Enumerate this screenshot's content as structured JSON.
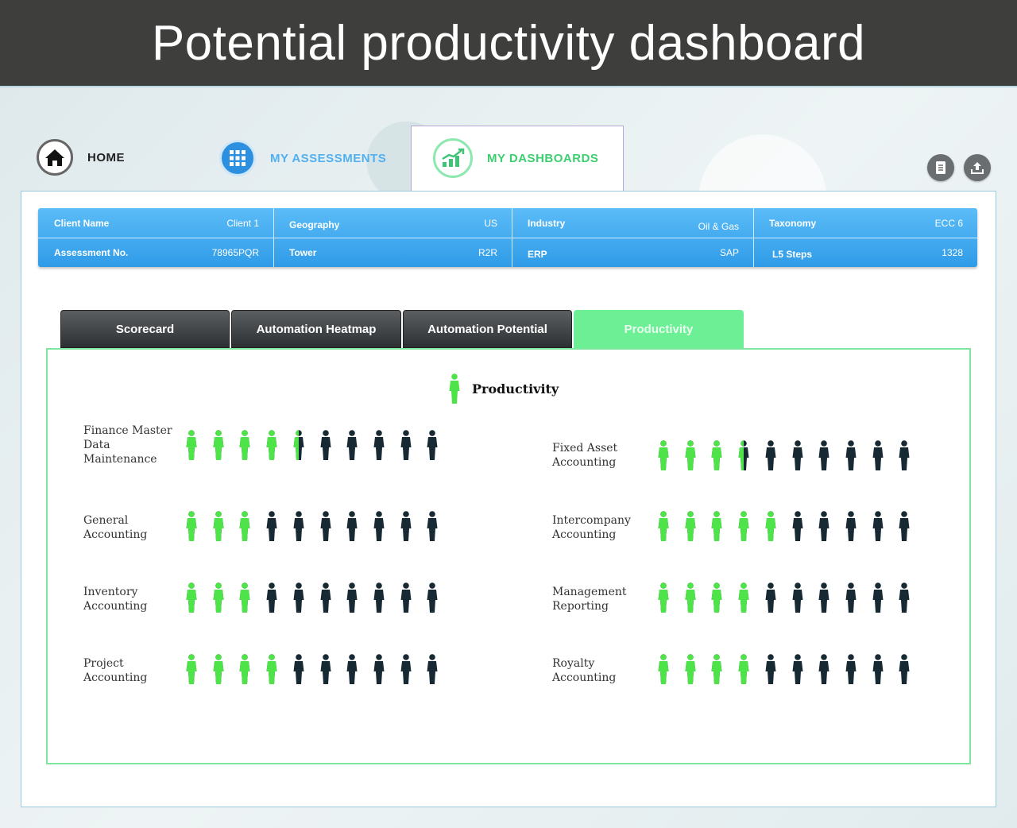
{
  "page_title": "Potential productivity dashboard",
  "nav": {
    "home": "HOME",
    "assessments": "MY ASSESSMENTS",
    "dashboards": "MY DASHBOARDS"
  },
  "info": {
    "row1": [
      {
        "label": "Client Name",
        "value": "Client 1"
      },
      {
        "label": "Geography",
        "value": "US"
      },
      {
        "label": "Industry",
        "value": "Oil & Gas"
      },
      {
        "label": "Taxonomy",
        "value": "ECC 6"
      }
    ],
    "row2": [
      {
        "label": "Assessment No.",
        "value": "78965PQR"
      },
      {
        "label": "Tower",
        "value": "R2R"
      },
      {
        "label": "ERP",
        "value": "SAP"
      },
      {
        "label": "L5 Steps",
        "value": "1328"
      }
    ]
  },
  "tabs": [
    "Scorecard",
    "Automation Heatmap",
    "Automation Potential",
    "Productivity"
  ],
  "active_tab": "Productivity",
  "legend": "Productivity",
  "colors": {
    "productive": "#4fe34a",
    "other": "#172a33",
    "accent": "#6df095",
    "blue": "#2f9be8"
  },
  "icons": [
    "home-icon",
    "grid-icon",
    "chart-icon",
    "document-icon",
    "upload-icon",
    "person-icon"
  ],
  "chart_data": {
    "type": "pictogram",
    "scale_max": 10,
    "series": [
      {
        "name": "Finance Master\nData\nMaintenance",
        "value": 4.5
      },
      {
        "name": "General\nAccounting",
        "value": 3
      },
      {
        "name": "Inventory\nAccounting",
        "value": 3
      },
      {
        "name": "Project\nAccounting",
        "value": 4
      },
      {
        "name": "Fixed Asset\nAccounting",
        "value": 3.5
      },
      {
        "name": "Intercompany\nAccounting",
        "value": 5
      },
      {
        "name": "Management\nReporting",
        "value": 4
      },
      {
        "name": "Royalty\nAccounting",
        "value": 4
      }
    ]
  }
}
